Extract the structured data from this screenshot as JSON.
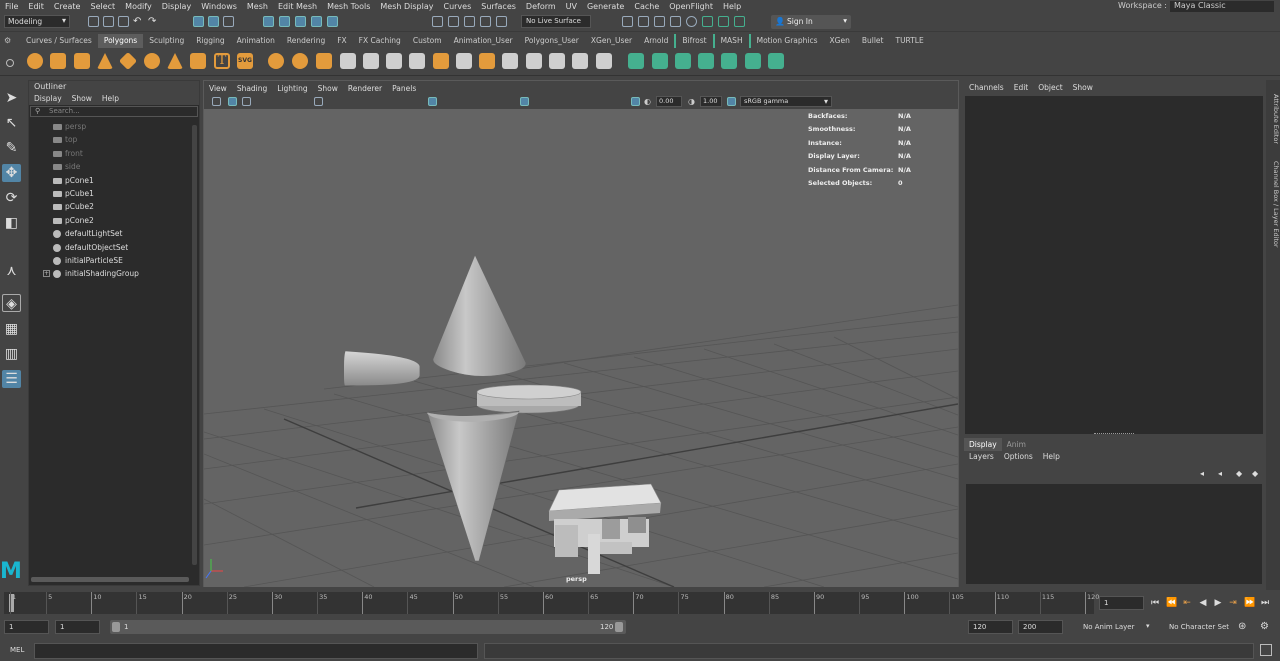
{
  "menubar": {
    "items": [
      "File",
      "Edit",
      "Create",
      "Select",
      "Modify",
      "Display",
      "Windows",
      "Mesh",
      "Edit Mesh",
      "Mesh Tools",
      "Mesh Display",
      "Curves",
      "Surfaces",
      "Deform",
      "UV",
      "Generate",
      "Cache",
      "OpenFlight",
      "Help"
    ],
    "workspace_label": "Workspace :",
    "workspace_value": "Maya Classic"
  },
  "statusline": {
    "mode": "Modeling",
    "live_surface": "No Live Surface",
    "sign_in": "Sign In"
  },
  "shelf": {
    "tabs": [
      "Curves / Surfaces",
      "Polygons",
      "Sculpting",
      "Rigging",
      "Animation",
      "Rendering",
      "FX",
      "FX Caching",
      "Custom",
      "Animation_User",
      "Polygons_User",
      "XGen_User",
      "Arnold",
      "Bifrost",
      "MASH",
      "Motion Graphics",
      "XGen",
      "Bullet",
      "TURTLE"
    ],
    "active_tab": "Polygons",
    "svg_label": "SVG",
    "text_label": "T"
  },
  "outliner": {
    "title": "Outliner",
    "menu": [
      "Display",
      "Show",
      "Help"
    ],
    "search_placeholder": "Search...",
    "items": [
      {
        "label": "persp",
        "dim": true,
        "icon": "camera-icon"
      },
      {
        "label": "top",
        "dim": true,
        "icon": "camera-icon"
      },
      {
        "label": "front",
        "dim": true,
        "icon": "camera-icon"
      },
      {
        "label": "side",
        "dim": true,
        "icon": "camera-icon"
      },
      {
        "label": "pCone1",
        "dim": false,
        "icon": "mesh-icon"
      },
      {
        "label": "pCube1",
        "dim": false,
        "icon": "mesh-icon"
      },
      {
        "label": "pCube2",
        "dim": false,
        "icon": "mesh-icon"
      },
      {
        "label": "pCone2",
        "dim": false,
        "icon": "mesh-icon"
      },
      {
        "label": "defaultLightSet",
        "dim": false,
        "icon": "set-icon"
      },
      {
        "label": "defaultObjectSet",
        "dim": false,
        "icon": "set-icon"
      },
      {
        "label": "initialParticleSE",
        "dim": false,
        "icon": "set-icon"
      },
      {
        "label": "initialShadingGroup",
        "dim": false,
        "icon": "set-icon",
        "expandable": true
      }
    ]
  },
  "viewport": {
    "menu": [
      "View",
      "Shading",
      "Lighting",
      "Show",
      "Renderer",
      "Panels"
    ],
    "exposure": "0.00",
    "gamma": "1.00",
    "color_space": "sRGB gamma",
    "camera_label": "persp",
    "hud": [
      {
        "label": "Backfaces:",
        "value": "N/A"
      },
      {
        "label": "Smoothness:",
        "value": "N/A"
      },
      {
        "label": "Instance:",
        "value": "N/A"
      },
      {
        "label": "Display Layer:",
        "value": "N/A"
      },
      {
        "label": "Distance From Camera:",
        "value": "N/A"
      },
      {
        "label": "Selected Objects:",
        "value": "0"
      }
    ]
  },
  "channelbox": {
    "menu": [
      "Channels",
      "Edit",
      "Object",
      "Show"
    ]
  },
  "layers": {
    "tabs": [
      "Display",
      "Anim"
    ],
    "menu": [
      "Layers",
      "Options",
      "Help"
    ]
  },
  "side_tabs": [
    "Attribute Editor",
    "Channel Box / Layer Editor"
  ],
  "timeslider": {
    "labels": [
      "1",
      "5",
      "10",
      "15",
      "20",
      "25",
      "30",
      "35",
      "40",
      "45",
      "50",
      "55",
      "60",
      "65",
      "70",
      "75",
      "80",
      "85",
      "90",
      "95",
      "100",
      "105",
      "110",
      "115",
      "120"
    ],
    "current_frame": "1"
  },
  "range": {
    "start": "1",
    "playback_start": "1",
    "range_start": "1",
    "range_end": "120",
    "playback_end": "120",
    "end": "200",
    "anim_layer": "No Anim Layer",
    "character_set": "No Character Set"
  },
  "cmdline": {
    "lang": "MEL"
  },
  "colors": {
    "accent": "#5285a6",
    "shelf_orange": "#e39b3c",
    "shelf_green": "#45b08f",
    "logo": "#1ab6cf"
  }
}
